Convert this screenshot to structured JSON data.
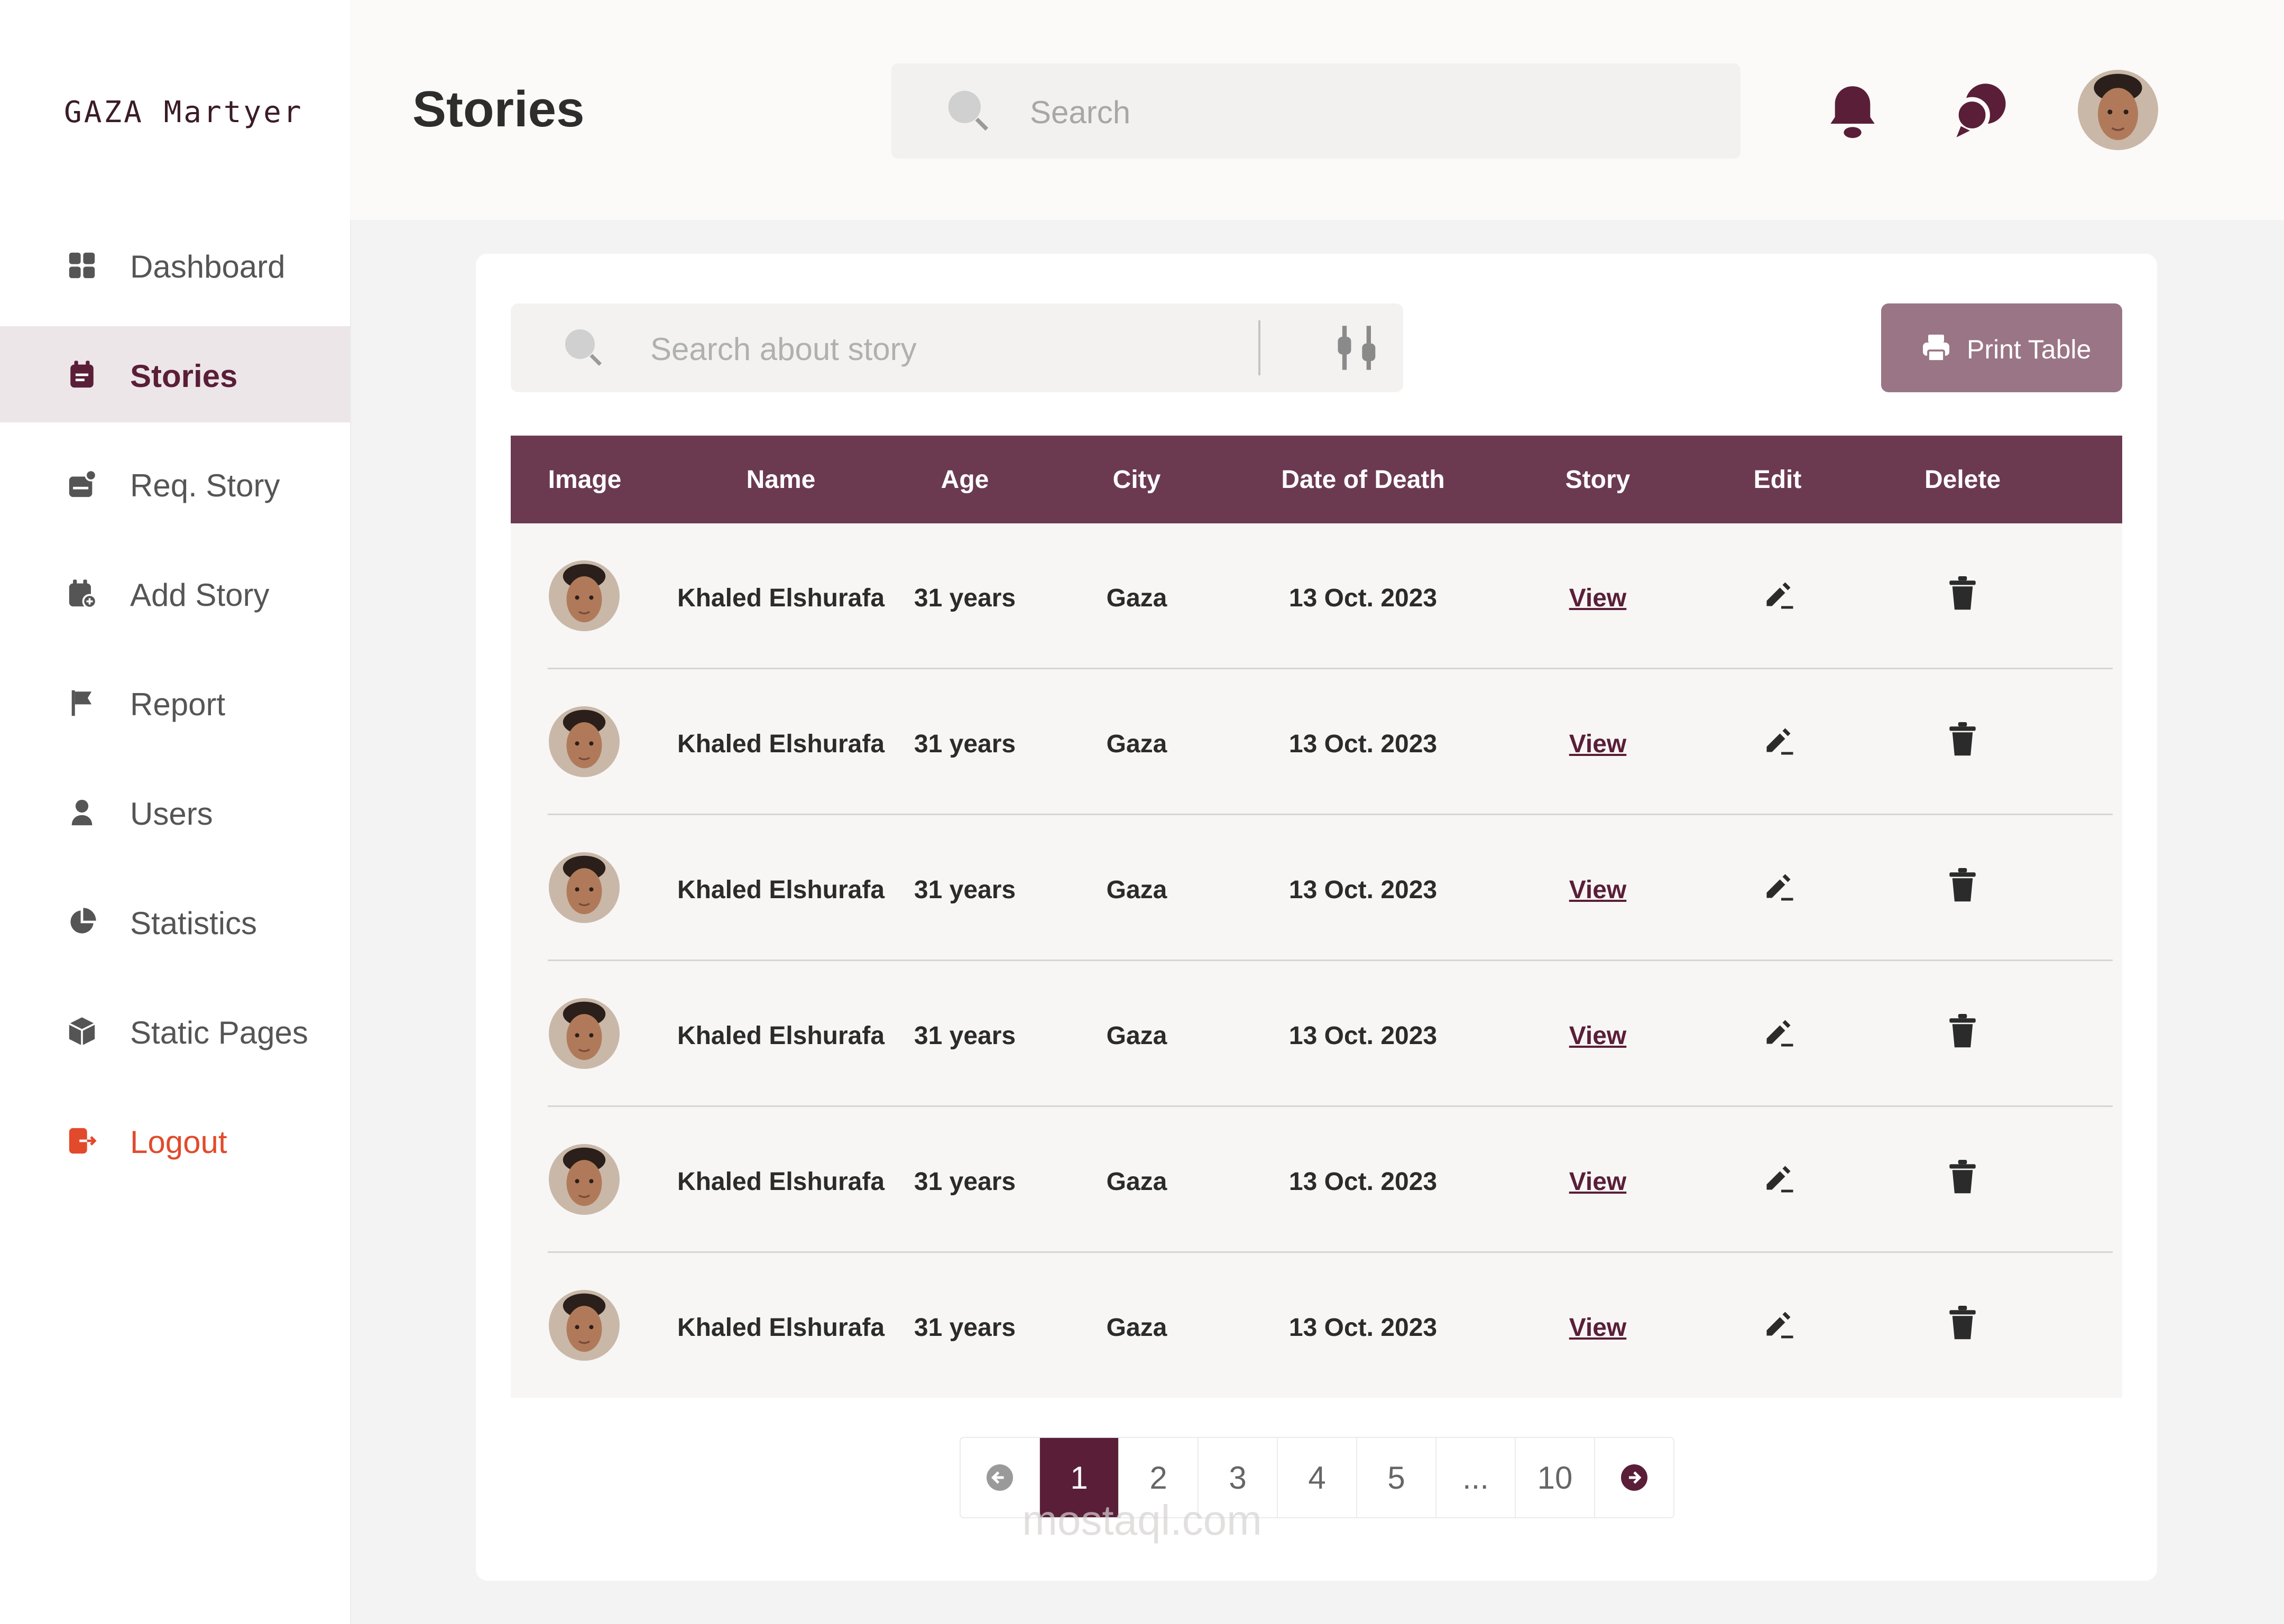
{
  "app": {
    "logo_text": "GAZA Martyer",
    "page_title": "Stories"
  },
  "sidebar": {
    "items": [
      {
        "label": "Dashboard",
        "icon": "grid-icon",
        "active": false
      },
      {
        "label": "Stories",
        "icon": "calendar-note-icon",
        "active": true
      },
      {
        "label": "Req. Story",
        "icon": "inbox-request-icon",
        "active": false
      },
      {
        "label": "Add Story",
        "icon": "calendar-add-icon",
        "active": false
      },
      {
        "label": "Report",
        "icon": "flag-icon",
        "active": false
      },
      {
        "label": "Users",
        "icon": "user-icon",
        "active": false
      },
      {
        "label": "Statistics",
        "icon": "pie-chart-icon",
        "active": false
      },
      {
        "label": "Static Pages",
        "icon": "cube-icon",
        "active": false
      },
      {
        "label": "Logout",
        "icon": "logout-icon",
        "active": false
      }
    ]
  },
  "header": {
    "search_placeholder": "Search"
  },
  "toolbar": {
    "story_search_placeholder": "Search about story",
    "print_label": "Print Table"
  },
  "table": {
    "columns": [
      "Image",
      "Name",
      "Age",
      "City",
      "Date of Death",
      "Story",
      "Edit",
      "Delete"
    ],
    "rows": [
      {
        "name": "Khaled Elshurafa",
        "age": "31 years",
        "city": "Gaza",
        "date": "13 Oct. 2023",
        "story": "View"
      },
      {
        "name": "Khaled Elshurafa",
        "age": "31 years",
        "city": "Gaza",
        "date": "13 Oct. 2023",
        "story": "View"
      },
      {
        "name": "Khaled Elshurafa",
        "age": "31 years",
        "city": "Gaza",
        "date": "13 Oct. 2023",
        "story": "View"
      },
      {
        "name": "Khaled Elshurafa",
        "age": "31 years",
        "city": "Gaza",
        "date": "13 Oct. 2023",
        "story": "View"
      },
      {
        "name": "Khaled Elshurafa",
        "age": "31 years",
        "city": "Gaza",
        "date": "13 Oct. 2023",
        "story": "View"
      },
      {
        "name": "Khaled Elshurafa",
        "age": "31 years",
        "city": "Gaza",
        "date": "13 Oct. 2023",
        "story": "View"
      }
    ]
  },
  "pagination": {
    "pages": [
      "1",
      "2",
      "3",
      "4",
      "5",
      "...",
      "10"
    ],
    "current": "1"
  },
  "watermark": "mostaql.com",
  "colors": {
    "primary": "#6b3a51",
    "dark": "#5a1e38",
    "button": "#9a7585",
    "logout": "#e24a2c"
  }
}
